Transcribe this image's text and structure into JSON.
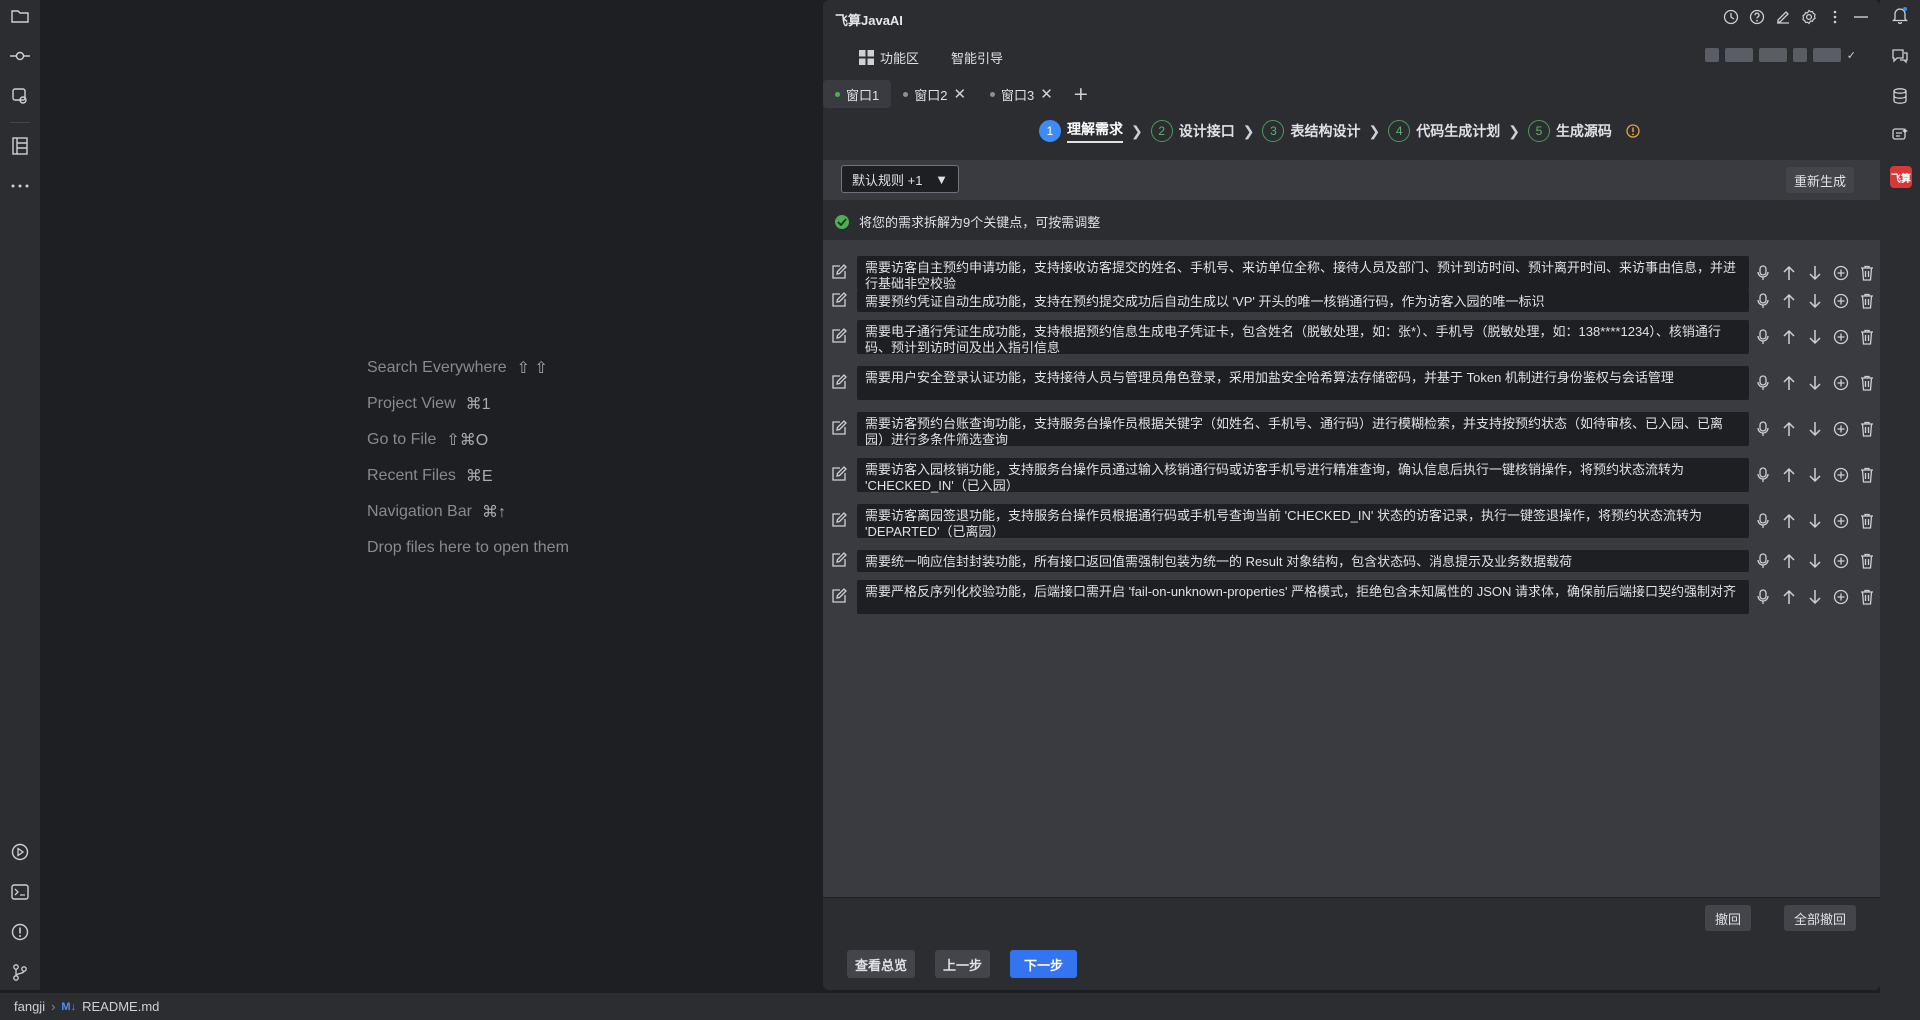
{
  "panel": {
    "title": "飞算JavaAI",
    "nav": [
      {
        "label": "功能区",
        "icon": "grid-icon"
      },
      {
        "label": "智能引导"
      }
    ],
    "user_caret": "✓",
    "window_tabs": [
      {
        "label": "窗口1",
        "active": true
      },
      {
        "label": "窗口2",
        "closable": true
      },
      {
        "label": "窗口3",
        "closable": true
      }
    ],
    "steps": [
      {
        "num": "1",
        "label": "理解需求",
        "current": true
      },
      {
        "num": "2",
        "label": "设计接口"
      },
      {
        "num": "3",
        "label": "表结构设计"
      },
      {
        "num": "4",
        "label": "代码生成计划"
      },
      {
        "num": "5",
        "label": "生成源码"
      }
    ],
    "rule_select": "默认规则 +1",
    "regenerate_label": "重新生成",
    "status_text": "将您的需求拆解为9个关键点，可按需调整",
    "requirements": [
      "需要访客自主预约申请功能，支持接收访客提交的姓名、手机号、来访单位全称、接待人员及部门、预计到访时间、预计离开时间、来访事由信息，并进行基础非空校验",
      "需要预约凭证自动生成功能，支持在预约提交成功后自动生成以 'VP' 开头的唯一核销通行码，作为访客入园的唯一标识",
      "需要电子通行凭证生成功能，支持根据预约信息生成电子凭证卡，包含姓名（脱敏处理，如：张*）、手机号（脱敏处理，如：138****1234）、核销通行码、预计到访时间及出入指引信息",
      "需要用户安全登录认证功能，支持接待人员与管理员角色登录，采用加盐安全哈希算法存储密码，并基于 Token 机制进行身份鉴权与会话管理",
      "需要访客预约台账查询功能，支持服务台操作员根据关键字（如姓名、手机号、通行码）进行模糊检索，并支持按预约状态（如待审核、已入园、已离园）进行多条件筛选查询",
      "需要访客入园核销功能，支持服务台操作员通过输入核销通行码或访客手机号进行精准查询，确认信息后执行一键核销操作，将预约状态流转为 'CHECKED_IN'（已入园）",
      "需要访客离园签退功能，支持服务台操作员根据通行码或手机号查询当前 'CHECKED_IN' 状态的访客记录，执行一键签退操作，将预约状态流转为 'DEPARTED'（已离园）",
      "需要统一响应信封封装功能，所有接口返回值需强制包装为统一的 Result 对象结构，包含状态码、消息提示及业务数据载荷",
      "需要严格反序列化校验功能，后端接口需开启 'fail-on-unknown-properties' 严格模式，拒绝包含未知属性的 JSON 请求体，确保前后端接口契约强制对齐"
    ],
    "undo_label": "撤回",
    "undo_all_label": "全部撤回",
    "footer": {
      "overview_label": "查看总览",
      "prev_label": "上一步",
      "next_label": "下一步"
    }
  },
  "welcome": [
    {
      "label": "Search Everywhere",
      "shortcut": "⇧ ⇧"
    },
    {
      "label": "Project View",
      "shortcut": "⌘1"
    },
    {
      "label": "Go to File",
      "shortcut": "⇧⌘O"
    },
    {
      "label": "Recent Files",
      "shortcut": "⌘E"
    },
    {
      "label": "Navigation Bar",
      "shortcut": "⌘↑"
    },
    {
      "label": "Drop files here to open them",
      "shortcut": ""
    }
  ],
  "right_strip": {
    "badge": "飞算"
  },
  "statusbar": {
    "project": "fangji",
    "file_badge": "M↓",
    "file": "README.md"
  }
}
